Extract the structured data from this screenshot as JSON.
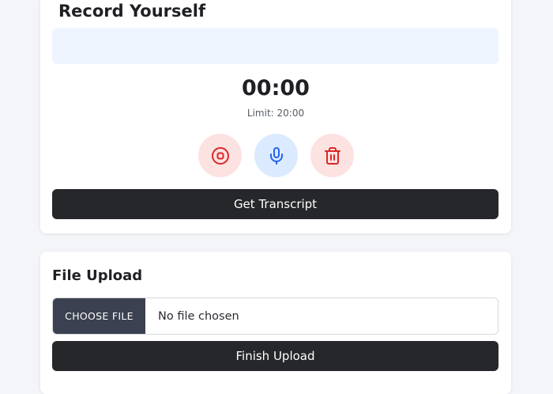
{
  "record": {
    "title": "Record Yourself",
    "timer": "00:00",
    "limit": "Limit: 20:00",
    "get_transcript_label": "Get Transcript"
  },
  "upload": {
    "title": "File Upload",
    "choose_file_label": "CHOOSE FILE",
    "file_status": "No file chosen",
    "finish_label": "Finish Upload"
  },
  "colors": {
    "stop_icon": "#dc2626",
    "mic_icon": "#2563eb",
    "delete_icon": "#dc2626",
    "stop_bg": "#fde2e2",
    "mic_bg": "#dbeafe",
    "transcript_bg": "#eef5fe",
    "dark_button": "#26272b"
  },
  "icons": {
    "stop": "stop-circle-icon",
    "mic": "microphone-icon",
    "delete": "trash-icon"
  }
}
